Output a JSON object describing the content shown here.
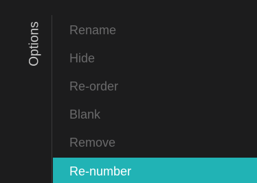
{
  "panel": {
    "title": "Options"
  },
  "menu": {
    "items": [
      {
        "label": "Rename",
        "selected": false
      },
      {
        "label": "Hide",
        "selected": false
      },
      {
        "label": "Re-order",
        "selected": false
      },
      {
        "label": "Blank",
        "selected": false
      },
      {
        "label": "Remove",
        "selected": false
      },
      {
        "label": "Re-number",
        "selected": true
      }
    ]
  },
  "colors": {
    "background": "#1c1c1d",
    "highlight": "#21b3b5",
    "item_text": "#6a6a6b",
    "selected_text": "#ffffff",
    "title_text": "#c9c9c9"
  }
}
